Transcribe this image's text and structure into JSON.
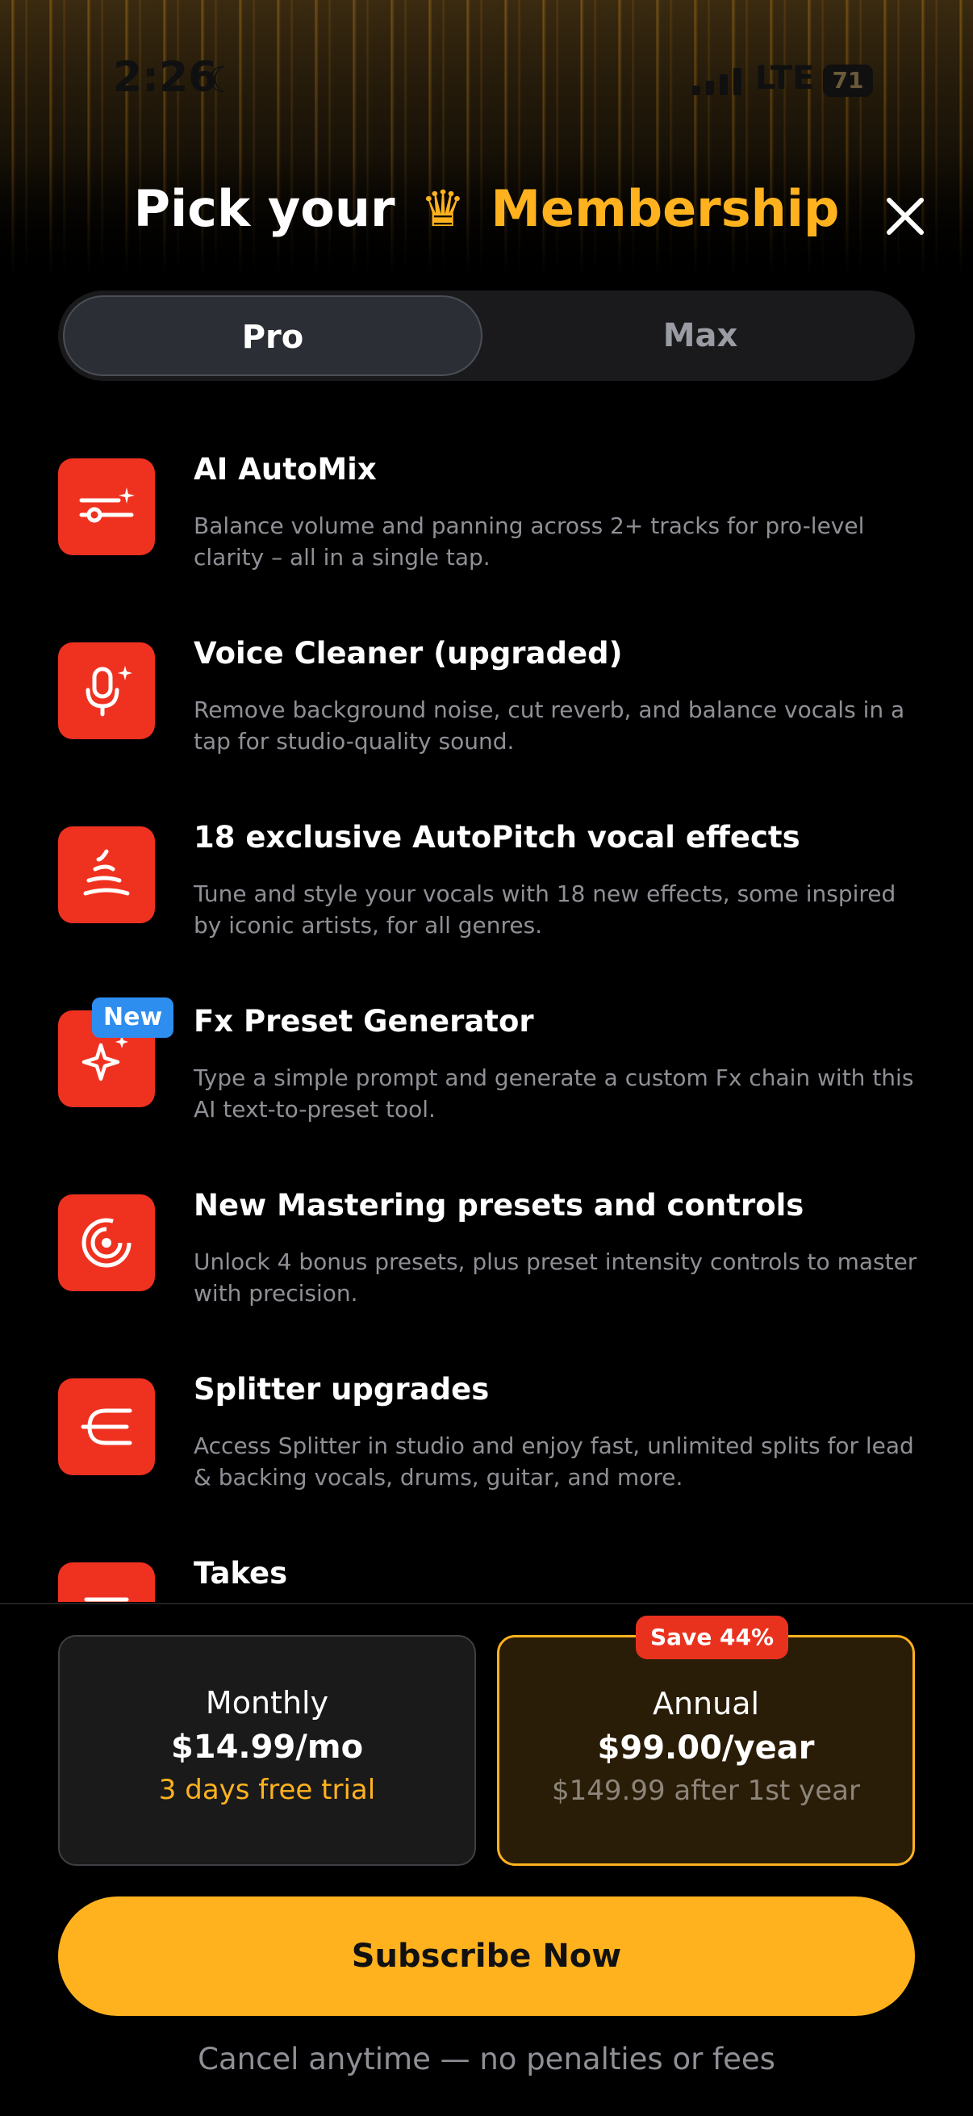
{
  "status_bar": {
    "time": "2:26",
    "network": "LTE",
    "battery": "71"
  },
  "header": {
    "title_prefix": "Pick your",
    "crown_glyph": "♛",
    "title_accent": "Membership"
  },
  "plan_toggle": {
    "options": [
      "Pro",
      "Max"
    ],
    "selected": "Pro"
  },
  "features": [
    {
      "icon": "automix-sliders-icon",
      "title": "AI AutoMix",
      "description": "Balance volume and panning across 2+ tracks for pro-level clarity – all in a single tap."
    },
    {
      "icon": "microphone-sparkle-icon",
      "title": "Voice Cleaner (upgraded)",
      "description": "Remove background noise, cut reverb, and balance vocals in a tap for studio-quality sound."
    },
    {
      "icon": "autopitch-wave-icon",
      "title": "18 exclusive AutoPitch vocal effects",
      "description": "Tune and style your vocals with 18 new effects, some inspired by iconic artists, for all genres."
    },
    {
      "icon": "sparkle-icon",
      "badge": "New",
      "title": "Fx Preset Generator",
      "description": "Type a simple prompt and generate a custom Fx chain with this AI text-to-preset tool."
    },
    {
      "icon": "mastering-spiral-icon",
      "title": "New Mastering presets and controls",
      "description": "Unlock 4 bonus presets, plus preset intensity controls to master with precision."
    },
    {
      "icon": "splitter-icon",
      "title": "Splitter upgrades",
      "description": "Access Splitter in studio and enjoy fast, unlimited splits for lead & backing vocals, drums, guitar, and more."
    },
    {
      "icon": "takes-icon",
      "title": "Takes",
      "description": ""
    }
  ],
  "plans": {
    "monthly": {
      "name": "Monthly",
      "price": "$14.99/mo",
      "sub": "3 days free trial"
    },
    "annual": {
      "name": "Annual",
      "price": "$99.00/year",
      "sub": "$149.99 after 1st year",
      "badge": "Save 44%",
      "selected": true
    }
  },
  "cta": {
    "label": "Subscribe Now"
  },
  "footer": {
    "note": "Cancel anytime — no penalties or fees"
  },
  "colors": {
    "accent": "#ffb21e",
    "icon_bg": "#ef3220",
    "badge_blue": "#2e8ef0",
    "save_red": "#e9321e"
  }
}
